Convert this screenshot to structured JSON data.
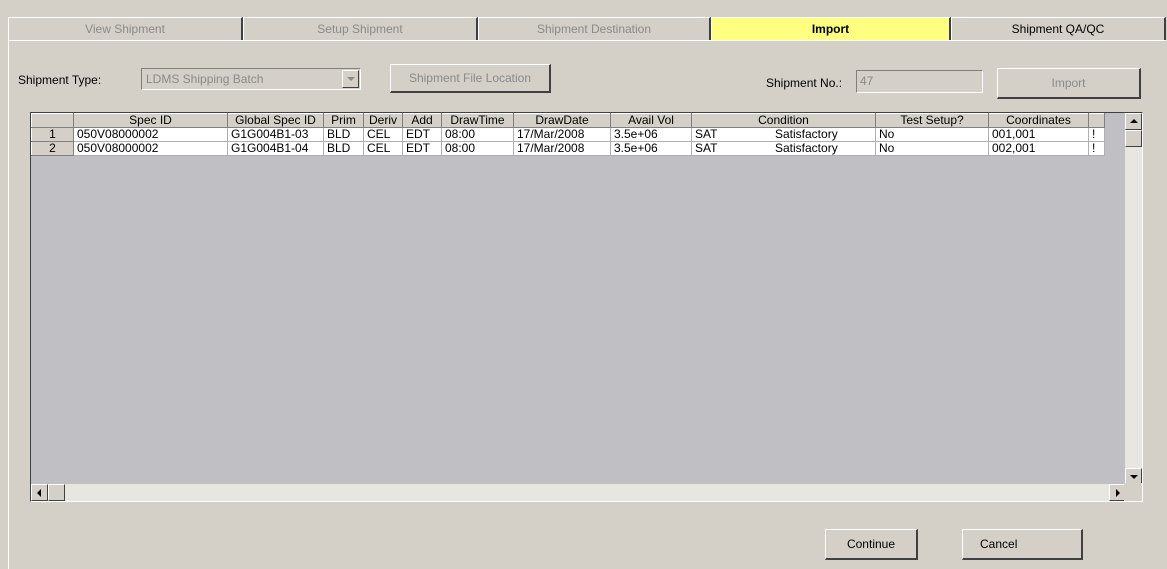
{
  "tabs": [
    {
      "label": "View Shipment",
      "state": "disabled"
    },
    {
      "label": "Setup Shipment",
      "state": "disabled"
    },
    {
      "label": "Shipment Destination",
      "state": "disabled"
    },
    {
      "label": "Import",
      "state": "active"
    },
    {
      "label": "Shipment QA/QC",
      "state": "enabled"
    }
  ],
  "toolbar": {
    "shipment_type_label": "Shipment Type:",
    "shipment_type_value": "LDMS Shipping Batch",
    "file_location_button": "Shipment File Location",
    "shipment_no_label": "Shipment No.:",
    "shipment_no_value": "47",
    "import_button": "Import"
  },
  "grid": {
    "columns": [
      "Spec ID",
      "Global Spec ID",
      "Prim",
      "Deriv",
      "Add",
      "DrawTime",
      "DrawDate",
      "Avail Vol",
      "Condition",
      "Test Setup?",
      "Coordinates"
    ],
    "rows": [
      {
        "num": "1",
        "spec_id": "050V08000002",
        "global_spec_id": "G1G004B1-03",
        "prim": "BLD",
        "deriv": "CEL",
        "add": "EDT",
        "draw_time": "08:00",
        "draw_date": "17/Mar/2008",
        "avail_vol": "3.5e+06",
        "condition_code": "SAT",
        "condition_text": "Satisfactory",
        "test_setup": "No",
        "coordinates": "001,001",
        "cutoff": "!"
      },
      {
        "num": "2",
        "spec_id": "050V08000002",
        "global_spec_id": "G1G004B1-04",
        "prim": "BLD",
        "deriv": "CEL",
        "add": "EDT",
        "draw_time": "08:00",
        "draw_date": "17/Mar/2008",
        "avail_vol": "3.5e+06",
        "condition_code": "SAT",
        "condition_text": "Satisfactory",
        "test_setup": "No",
        "coordinates": "002,001",
        "cutoff": "!"
      }
    ]
  },
  "footer": {
    "continue_button": "Continue",
    "cancel_button": "Cancel"
  }
}
